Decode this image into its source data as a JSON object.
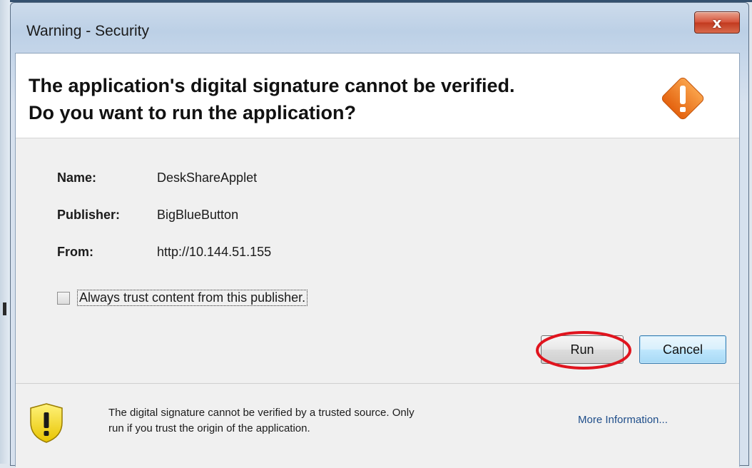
{
  "window": {
    "title": "Warning - Security",
    "close_label": "x"
  },
  "header": {
    "line1": "The application's digital signature cannot be verified.",
    "line2": "Do you want to run the application?",
    "icon": "warning-diamond-icon"
  },
  "details": {
    "name_label": "Name:",
    "name_value": "DeskShareApplet",
    "publisher_label": "Publisher:",
    "publisher_value": "BigBlueButton",
    "from_label": "From:",
    "from_value": "http://10.144.51.155"
  },
  "trust_checkbox": {
    "label": "Always trust content from this publisher.",
    "checked": false
  },
  "buttons": {
    "run": "Run",
    "cancel": "Cancel"
  },
  "footer": {
    "icon": "shield-warning-icon",
    "text_line1": "The digital signature cannot be verified by a trusted source.  Only",
    "text_line2": "run if you trust the origin of the application.",
    "more_info": "More Information..."
  },
  "colors": {
    "annotation_circle": "#e0141e",
    "warning_orange": "#f07a1a",
    "link": "#1f4e8a"
  }
}
